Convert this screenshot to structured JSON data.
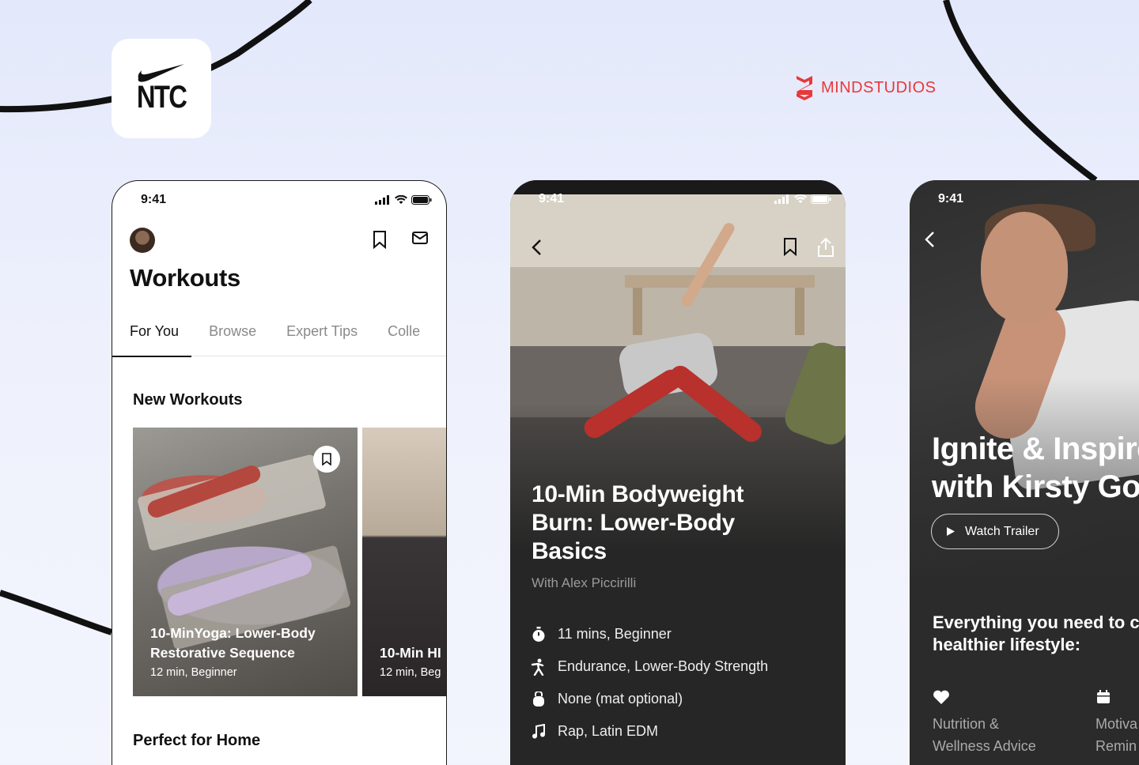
{
  "app_icon": {
    "brand_text": "NTC"
  },
  "partner": {
    "name": "MINDSTUDIOS"
  },
  "screen1": {
    "status_time": "9:41",
    "title": "Workouts",
    "tabs": [
      "For You",
      "Browse",
      "Expert Tips",
      "Colle"
    ],
    "section_new": "New Workouts",
    "cards": [
      {
        "title": "10-MinYoga: Lower-Body Restorative Sequence",
        "meta": "12 min, Beginner"
      },
      {
        "title": "10-Min HI",
        "meta": "12 min, Beg"
      }
    ],
    "section_home": "Perfect for Home"
  },
  "screen2": {
    "status_time": "9:41",
    "title": "10-Min Bodyweight Burn: Lower-Body Basics",
    "coach": "With Alex Piccirilli",
    "details": [
      {
        "icon": "stopwatch-icon",
        "text": "11 mins, Beginner"
      },
      {
        "icon": "runner-icon",
        "text": "Endurance, Lower-Body Strength"
      },
      {
        "icon": "kettlebell-icon",
        "text": "None (mat optional)"
      },
      {
        "icon": "music-note-icon",
        "text": "Rap, Latin EDM"
      }
    ]
  },
  "screen3": {
    "status_time": "9:41",
    "title_line1": "Ignite & Inspire",
    "title_line2": "with Kirsty Go",
    "trailer_label": "Watch Trailer",
    "need_line1": "Everything you need to c",
    "need_line2": "healthier lifestyle:",
    "features": [
      {
        "icon": "heart-icon",
        "line1": "Nutrition &",
        "line2": "Wellness Advice"
      },
      {
        "icon": "calendar-icon",
        "line1": "Motiva",
        "line2": "Remin"
      }
    ]
  },
  "colors": {
    "accent_red": "#e8393a",
    "dark_bg": "#262626"
  }
}
